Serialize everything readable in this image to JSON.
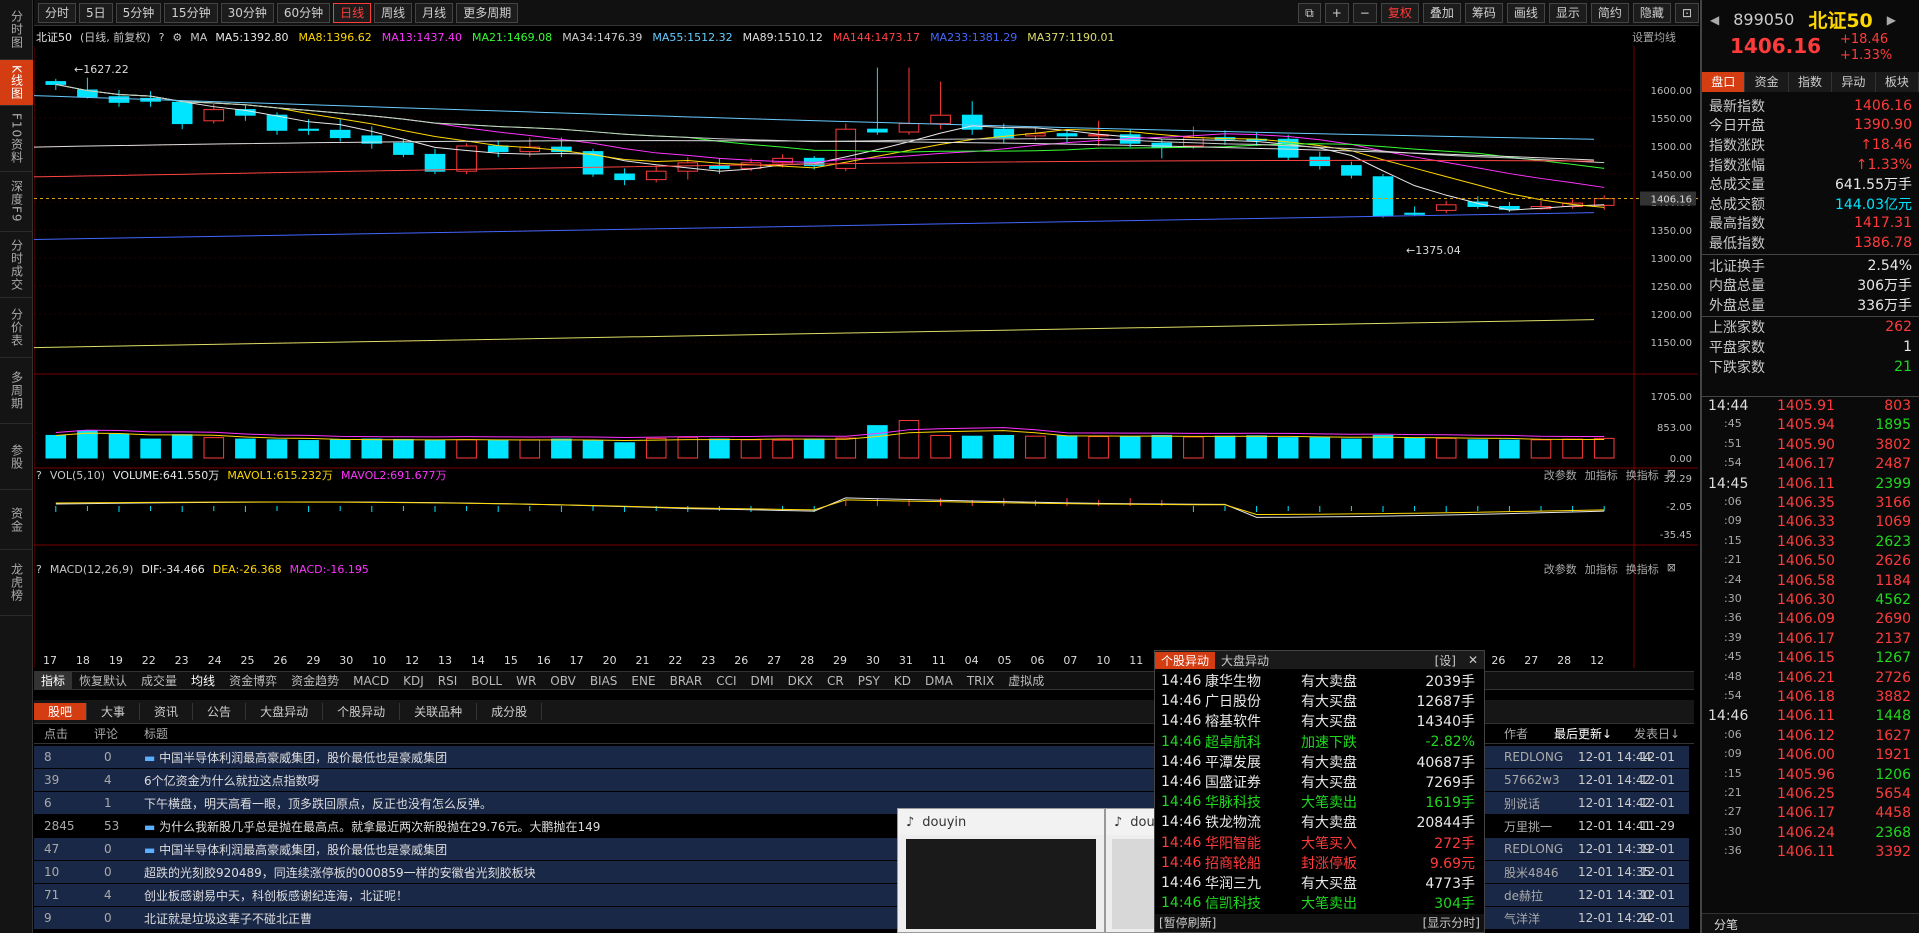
{
  "left_nav": [
    "分时图",
    "K线图",
    "F10资料",
    "深度F9",
    "分时成交",
    "分价表",
    "多周期",
    "参股",
    "资金",
    "龙虎榜"
  ],
  "toolbar": {
    "periods": [
      "分时",
      "5日",
      "5分钟",
      "15分钟",
      "30分钟",
      "60分钟",
      "日线",
      "周线",
      "月线",
      "更多周期"
    ],
    "active": "日线",
    "right": [
      "复权",
      "叠加",
      "筹码",
      "画线",
      "显示",
      "简约",
      "隐藏"
    ]
  },
  "ma_line": {
    "name": "北证50",
    "mode": "(日线, 前复权)",
    "ma": "MA",
    "items": [
      {
        "t": "MA5:1392.80",
        "c": "#e8e8e8"
      },
      {
        "t": "MA8:1396.62",
        "c": "#ffd700"
      },
      {
        "t": "MA13:1437.40",
        "c": "#ff33ff"
      },
      {
        "t": "MA21:1469.08",
        "c": "#33ff33"
      },
      {
        "t": "MA34:1476.39",
        "c": "#cccccc"
      },
      {
        "t": "MA55:1512.32",
        "c": "#66ccff"
      },
      {
        "t": "MA89:1510.12",
        "c": "#dddddd"
      },
      {
        "t": "MA144:1473.17",
        "c": "#ff4444"
      },
      {
        "t": "MA233:1381.29",
        "c": "#4466ff"
      },
      {
        "t": "MA377:1190.01",
        "c": "#dddd66"
      }
    ],
    "settings": "设置均线"
  },
  "kchart": {
    "high_label": "1627.22",
    "low_label": "1375.04",
    "current_price_label": "1406.16",
    "y_ticks": [
      "1600.00",
      "1550.00",
      "1500.00",
      "1450.00",
      "1400.00",
      "1350.00",
      "1300.00",
      "1250.00",
      "1200.00",
      "1150.00"
    ],
    "candles": [
      [
        1615,
        1610,
        1620,
        1600
      ],
      [
        1600,
        1588,
        1622,
        1585
      ],
      [
        1588,
        1578,
        1600,
        1570
      ],
      [
        1585,
        1580,
        1598,
        1570
      ],
      [
        1578,
        1540,
        1582,
        1530
      ],
      [
        1545,
        1565,
        1575,
        1540
      ],
      [
        1565,
        1555,
        1572,
        1545
      ],
      [
        1555,
        1528,
        1560,
        1520
      ],
      [
        1530,
        1528,
        1548,
        1520
      ],
      [
        1528,
        1515,
        1548,
        1508
      ],
      [
        1518,
        1505,
        1535,
        1495
      ],
      [
        1505,
        1485,
        1512,
        1480
      ],
      [
        1485,
        1455,
        1495,
        1450
      ],
      [
        1455,
        1500,
        1505,
        1450
      ],
      [
        1500,
        1490,
        1510,
        1480
      ],
      [
        1490,
        1498,
        1515,
        1480
      ],
      [
        1498,
        1490,
        1515,
        1480
      ],
      [
        1490,
        1450,
        1495,
        1445
      ],
      [
        1450,
        1440,
        1460,
        1430
      ],
      [
        1440,
        1455,
        1465,
        1435
      ],
      [
        1455,
        1470,
        1480,
        1440
      ],
      [
        1465,
        1460,
        1478,
        1450
      ],
      [
        1460,
        1470,
        1478,
        1455
      ],
      [
        1470,
        1478,
        1485,
        1462
      ],
      [
        1478,
        1465,
        1482,
        1458
      ],
      [
        1460,
        1530,
        1540,
        1455
      ],
      [
        1530,
        1525,
        1640,
        1520
      ],
      [
        1525,
        1540,
        1640,
        1520
      ],
      [
        1540,
        1555,
        1615,
        1530
      ],
      [
        1555,
        1530,
        1580,
        1520
      ],
      [
        1530,
        1515,
        1540,
        1505
      ],
      [
        1518,
        1522,
        1535,
        1510
      ],
      [
        1522,
        1518,
        1530,
        1505
      ],
      [
        1518,
        1520,
        1545,
        1500
      ],
      [
        1520,
        1505,
        1530,
        1498
      ],
      [
        1505,
        1498,
        1512,
        1478
      ],
      [
        1500,
        1515,
        1535,
        1495
      ],
      [
        1515,
        1512,
        1528,
        1502
      ],
      [
        1512,
        1510,
        1525,
        1500
      ],
      [
        1512,
        1480,
        1520,
        1475
      ],
      [
        1480,
        1465,
        1490,
        1458
      ],
      [
        1465,
        1448,
        1472,
        1442
      ],
      [
        1445,
        1375,
        1450,
        1372
      ],
      [
        1380,
        1378,
        1392,
        1375
      ],
      [
        1385,
        1395,
        1402,
        1380
      ],
      [
        1400,
        1392,
        1410,
        1388
      ],
      [
        1392,
        1387,
        1400,
        1382
      ],
      [
        1388,
        1392,
        1402,
        1386
      ],
      [
        1392,
        1398,
        1405,
        1388
      ],
      [
        1394,
        1406,
        1412,
        1386
      ]
    ],
    "x_labels": [
      "17",
      "18",
      "19",
      "22",
      "23",
      "24",
      "25",
      "26",
      "29",
      "30",
      "10",
      "12",
      "13",
      "14",
      "15",
      "16",
      "17",
      "20",
      "21",
      "22",
      "23",
      "26",
      "27",
      "28",
      "29",
      "30",
      "31",
      "11",
      "04",
      "05",
      "06",
      "07",
      "10",
      "11",
      "12",
      "13",
      "14",
      "17",
      "18",
      "19",
      "20",
      "21",
      "24",
      "25",
      "26",
      "27",
      "28",
      "12"
    ]
  },
  "vol": {
    "header": "VOL(5,10)",
    "volume": "VOLUME:641.550万",
    "mavol1": "MAVOL1:615.232万",
    "mavol2": "MAVOL2:691.677万",
    "y_ticks": [
      "1705.00",
      "853.00",
      "0.00"
    ],
    "buttons": [
      "改参数",
      "加指标",
      "换指标"
    ],
    "values": [
      620,
      750,
      650,
      520,
      640,
      560,
      520,
      500,
      480,
      500,
      520,
      510,
      490,
      500,
      480,
      500,
      520,
      480,
      420,
      540,
      570,
      520,
      500,
      490,
      520,
      550,
      890,
      1030,
      620,
      600,
      620,
      600,
      610,
      590,
      580,
      620,
      580,
      600,
      610,
      560,
      560,
      520,
      620,
      540,
      540,
      500,
      490,
      500,
      520,
      540,
      560
    ]
  },
  "macd": {
    "header": "MACD(12,26,9)",
    "dif": "DIF:-34.466",
    "dea": "DEA:-26.368",
    "macd": "MACD:-16.195",
    "y_ticks": [
      "32.29",
      "-2.05",
      "-35.45"
    ],
    "buttons": [
      "改参数",
      "加指标",
      "换指标"
    ]
  },
  "indicator_tabs": {
    "label": "指标",
    "items": [
      "恢复默认",
      "成交量",
      "均线",
      "资金博弈",
      "资金趋势",
      "MACD",
      "KDJ",
      "RSI",
      "BOLL",
      "WR",
      "OBV",
      "BIAS",
      "ENE",
      "BRAR",
      "CCI",
      "DMI",
      "DKX",
      "CR",
      "PSY",
      "KD",
      "DMA",
      "TRIX",
      "虚拟成"
    ],
    "active": "均线"
  },
  "news": {
    "tabs": [
      "股吧",
      "大事",
      "资讯",
      "公告",
      "大盘异动",
      "个股异动",
      "关联品种",
      "成分股"
    ],
    "active": "股吧",
    "headers": {
      "clicks": "点击",
      "comments": "评论",
      "title": "标题",
      "author": "作者",
      "last_update": "最后更新↓",
      "post_date": "发表日↓"
    },
    "rows": [
      {
        "c": "8",
        "r": "0",
        "t": "中国半导体利润最高豪威集团，股价最低也是豪威集团",
        "a": "REDLONG",
        "u": "12-01 14:44",
        "d": "12-01",
        "hi": true,
        "img": true
      },
      {
        "c": "39",
        "r": "4",
        "t": "6个亿资金为什么就拉这点指数呀",
        "a": "57662w3",
        "u": "12-01 14:42",
        "d": "12-01",
        "hi": true,
        "img": false
      },
      {
        "c": "6",
        "r": "1",
        "t": "下午横盘，明天高看一眼，顶多跌回原点，反正也没有怎么反弹。",
        "a": "别说话",
        "u": "12-01 14:42",
        "d": "12-01",
        "hi": true,
        "img": false
      },
      {
        "c": "2845",
        "r": "53",
        "t": "为什么我新股几乎总是抛在最高点。就拿最近两次新股抛在29.76元。大鹏抛在149",
        "a": "万里挑一",
        "u": "12-01 14:41",
        "d": "11-29",
        "hi": false,
        "img": true
      },
      {
        "c": "47",
        "r": "0",
        "t": "中国半导体利润最高豪威集团，股价最低也是豪威集团",
        "a": "REDLONG",
        "u": "12-01 14:39",
        "d": "12-01",
        "hi": true,
        "img": true
      },
      {
        "c": "10",
        "r": "0",
        "t": "超跌的光刻胶920489，同连续涨停板的000859一样的安徽省光刻胶板块",
        "a": "股米4846",
        "u": "12-01 14:35",
        "d": "12-01",
        "hi": true,
        "img": false
      },
      {
        "c": "71",
        "r": "4",
        "t": "创业板感谢易中天，科创板感谢纪连海，北证呢！",
        "a": "de赫拉",
        "u": "12-01 14:30",
        "d": "12-01",
        "hi": true,
        "img": false
      },
      {
        "c": "9",
        "r": "0",
        "t": "北证就是垃圾这辈子不碰北正曹",
        "a": "气洋洋",
        "u": "12-01 14:24",
        "d": "12-01",
        "hi": true,
        "img": false
      }
    ]
  },
  "alerts": {
    "tabs": [
      "个股异动",
      "大盘异动"
    ],
    "set": "[设]",
    "footer_left": "[暂停刷新]",
    "footer_right": "[显示分时]",
    "rows": [
      {
        "t": "14:46",
        "n": "康华生物",
        "e": "有大卖盘",
        "v": "2039手",
        "c": "wht"
      },
      {
        "t": "14:46",
        "n": "广日股份",
        "e": "有大买盘",
        "v": "12687手",
        "c": "wht"
      },
      {
        "t": "14:46",
        "n": "榕基软件",
        "e": "有大买盘",
        "v": "14340手",
        "c": "wht"
      },
      {
        "t": "14:46",
        "n": "超卓航科",
        "e": "加速下跌",
        "v": "-2.82%",
        "c": "grn"
      },
      {
        "t": "14:46",
        "n": "平潭发展",
        "e": "有大卖盘",
        "v": "40687手",
        "c": "wht"
      },
      {
        "t": "14:46",
        "n": "国盛证券",
        "e": "有大买盘",
        "v": "7269手",
        "c": "wht"
      },
      {
        "t": "14:46",
        "n": "华脉科技",
        "e": "大笔卖出",
        "v": "1619手",
        "c": "grn"
      },
      {
        "t": "14:46",
        "n": "铁龙物流",
        "e": "有大卖盘",
        "v": "20844手",
        "c": "wht"
      },
      {
        "t": "14:46",
        "n": "华阳智能",
        "e": "大笔买入",
        "v": "272手",
        "c": "red"
      },
      {
        "t": "14:46",
        "n": "招商轮船",
        "e": "封涨停板",
        "v": "9.69元",
        "c": "red"
      },
      {
        "t": "14:46",
        "n": "华润三九",
        "e": "有大买盘",
        "v": "4773手",
        "c": "wht"
      },
      {
        "t": "14:46",
        "n": "信凯科技",
        "e": "大笔卖出",
        "v": "304手",
        "c": "grn"
      }
    ]
  },
  "douyin": [
    "douyin",
    "douyin"
  ],
  "quote": {
    "code": "899050",
    "name": "北证50",
    "price": "1406.16",
    "change": "+18.46",
    "pct": "+1.33%",
    "tabs": [
      "盘口",
      "资金",
      "指数",
      "异动",
      "板块"
    ],
    "rows": [
      {
        "l": "最新指数",
        "v": "1406.16",
        "c": "red"
      },
      {
        "l": "今日开盘",
        "v": "1390.90",
        "c": "red"
      },
      {
        "l": "指数涨跌",
        "v": "↑18.46",
        "c": "red"
      },
      {
        "l": "指数涨幅",
        "v": "↑1.33%",
        "c": "red"
      },
      {
        "l": "总成交量",
        "v": "641.55万手",
        "c": "wht"
      },
      {
        "l": "总成交额",
        "v": "144.03亿元",
        "c": "cyan"
      },
      {
        "l": "最高指数",
        "v": "1417.31",
        "c": "red"
      },
      {
        "l": "最低指数",
        "v": "1386.78",
        "c": "red"
      },
      {
        "l": "北证换手",
        "v": "2.54%",
        "c": "wht"
      },
      {
        "l": "内盘总量",
        "v": "306万手",
        "c": "wht"
      },
      {
        "l": "外盘总量",
        "v": "336万手",
        "c": "wht"
      },
      {
        "l": "上涨家数",
        "v": "262",
        "c": "red"
      },
      {
        "l": "平盘家数",
        "v": "1",
        "c": "wht"
      },
      {
        "l": "下跌家数",
        "v": "21",
        "c": "grn"
      }
    ],
    "ticks": [
      {
        "t": "14:44",
        "p": "1405.91",
        "v": "803",
        "big": true
      },
      {
        "t": ":45",
        "p": "1405.94",
        "v": "1895"
      },
      {
        "t": ":51",
        "p": "1405.90",
        "v": "3802"
      },
      {
        "t": ":54",
        "p": "1406.17",
        "v": "2487"
      },
      {
        "t": "14:45",
        "p": "1406.11",
        "v": "2399",
        "big": true
      },
      {
        "t": ":06",
        "p": "1406.35",
        "v": "3166"
      },
      {
        "t": ":09",
        "p": "1406.33",
        "v": "1069"
      },
      {
        "t": ":15",
        "p": "1406.33",
        "v": "2623"
      },
      {
        "t": ":21",
        "p": "1406.50",
        "v": "2626"
      },
      {
        "t": ":24",
        "p": "1406.58",
        "v": "1184"
      },
      {
        "t": ":30",
        "p": "1406.30",
        "v": "4562"
      },
      {
        "t": ":36",
        "p": "1406.09",
        "v": "2690"
      },
      {
        "t": ":39",
        "p": "1406.17",
        "v": "2137"
      },
      {
        "t": ":45",
        "p": "1406.15",
        "v": "1267"
      },
      {
        "t": ":48",
        "p": "1406.21",
        "v": "2726"
      },
      {
        "t": ":54",
        "p": "1406.18",
        "v": "3882"
      },
      {
        "t": "14:46",
        "p": "1406.11",
        "v": "1448",
        "big": true
      },
      {
        "t": ":06",
        "p": "1406.12",
        "v": "1627"
      },
      {
        "t": ":09",
        "p": "1406.00",
        "v": "1921"
      },
      {
        "t": ":15",
        "p": "1405.96",
        "v": "1206"
      },
      {
        "t": ":21",
        "p": "1406.25",
        "v": "5654"
      },
      {
        "t": ":27",
        "p": "1406.17",
        "v": "4458"
      },
      {
        "t": ":30",
        "p": "1406.24",
        "v": "2368"
      },
      {
        "t": ":36",
        "p": "1406.11",
        "v": "3392"
      }
    ],
    "bottom_tab": "分笔"
  }
}
